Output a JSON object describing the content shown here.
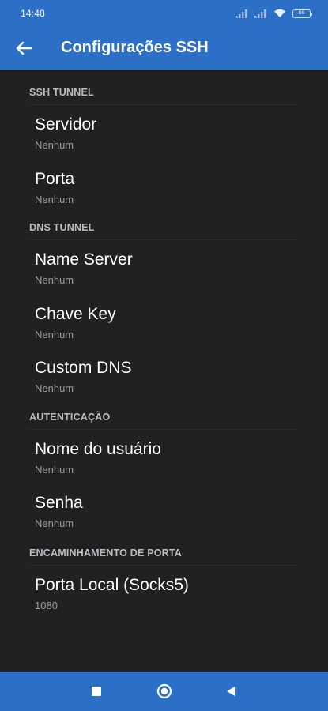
{
  "status_bar": {
    "time": "14:48",
    "battery_level": "66",
    "icons": [
      "signal-icon",
      "signal-icon",
      "wifi-icon",
      "battery-icon"
    ]
  },
  "app_bar": {
    "back_icon": "arrow-left-icon",
    "title": "Configurações SSH"
  },
  "sections": [
    {
      "header": "SSH TUNNEL",
      "items": [
        {
          "title": "Servidor",
          "summary": "Nenhum"
        },
        {
          "title": "Porta",
          "summary": "Nenhum"
        }
      ]
    },
    {
      "header": "DNS TUNNEL",
      "items": [
        {
          "title": "Name Server",
          "summary": "Nenhum"
        },
        {
          "title": "Chave Key",
          "summary": "Nenhum"
        },
        {
          "title": "Custom DNS",
          "summary": "Nenhum"
        }
      ]
    },
    {
      "header": "AUTENTICAÇÃO",
      "items": [
        {
          "title": "Nome do usuário",
          "summary": "Nenhum"
        },
        {
          "title": "Senha",
          "summary": "Nenhum"
        }
      ]
    },
    {
      "header": "ENCAMINHAMENTO DE PORTA",
      "items": [
        {
          "title": "Porta Local (Socks5)",
          "summary": "1080"
        }
      ]
    }
  ],
  "nav_bar": {
    "icons": [
      "recents-square-icon",
      "home-circle-icon",
      "back-triangle-icon"
    ]
  },
  "colors": {
    "primary": "#2c6fc6",
    "background": "#212121",
    "text_primary": "#ffffff",
    "text_secondary": "#9a9ea4",
    "section_header": "#b9bcc2"
  }
}
